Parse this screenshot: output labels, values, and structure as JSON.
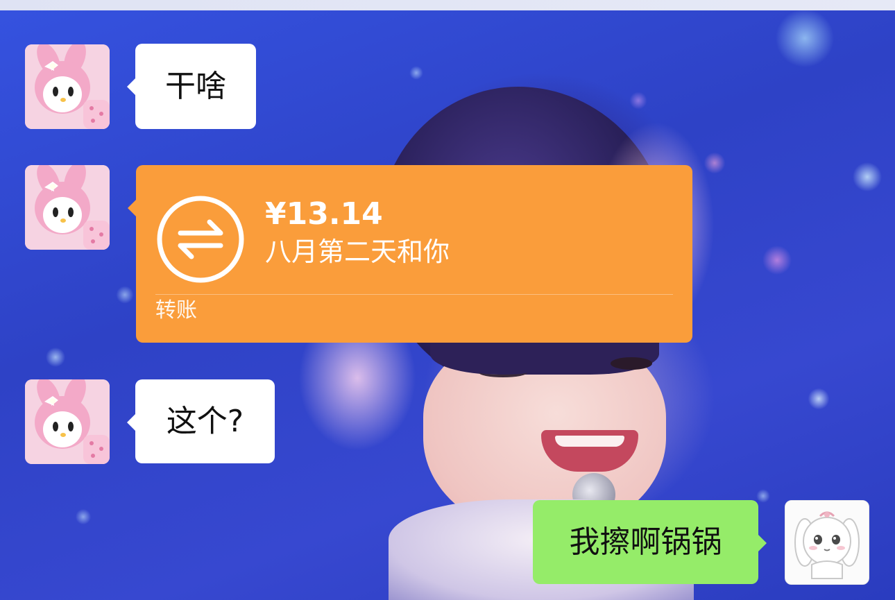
{
  "messages": [
    {
      "sender": "other",
      "type": "text",
      "text": "干啥"
    },
    {
      "sender": "other",
      "type": "transfer",
      "amount": "¥13.14",
      "note": "八月第二天和你",
      "label": "转账",
      "icon": "transfer-arrows-icon",
      "color": "#fa9d3b"
    },
    {
      "sender": "other",
      "type": "text",
      "text": "这个?"
    },
    {
      "sender": "me",
      "type": "text",
      "text": "我擦啊锅锅",
      "color": "#95ec69"
    }
  ],
  "avatars": {
    "other": "my-melody-avatar",
    "me": "white-bunny-avatar"
  }
}
